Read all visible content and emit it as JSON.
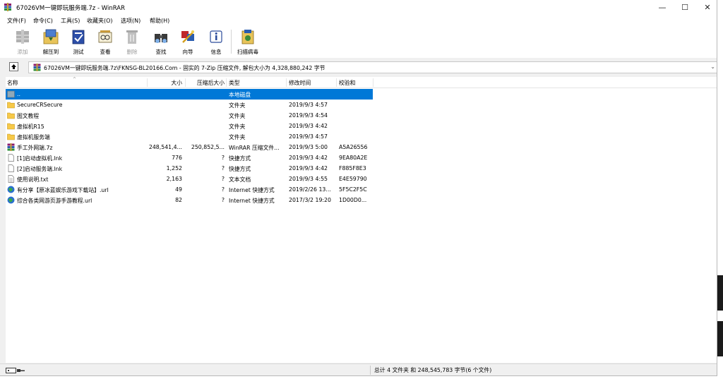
{
  "window": {
    "title": "67026VM一键即玩服务端.7z - WinRAR",
    "minimize": "—",
    "maximize": "☐",
    "close": "✕"
  },
  "menu": [
    "文件(F)",
    "命令(C)",
    "工具(S)",
    "收藏夹(O)",
    "选项(N)",
    "帮助(H)"
  ],
  "toolbar": [
    {
      "label": "添加",
      "icon": "add-icon",
      "enabled": false
    },
    {
      "label": "解压到",
      "icon": "extract-icon",
      "enabled": true
    },
    {
      "label": "测试",
      "icon": "test-icon",
      "enabled": true
    },
    {
      "label": "查看",
      "icon": "view-icon",
      "enabled": true
    },
    {
      "label": "删除",
      "icon": "delete-icon",
      "enabled": false
    },
    {
      "label": "查找",
      "icon": "find-icon",
      "enabled": true
    },
    {
      "label": "向导",
      "icon": "wizard-icon",
      "enabled": true
    },
    {
      "label": "信息",
      "icon": "info-icon",
      "enabled": true
    },
    {
      "label": "扫描病毒",
      "icon": "virus-scan-icon",
      "enabled": true
    }
  ],
  "address": {
    "path": "67026VM一键即玩服务端.7z\\FKNSG-BL20166.Com - 固实的 7-Zip 压缩文件, 解包大小为 4,328,880,242 字节"
  },
  "columns": [
    "名称",
    "大小",
    "压缩后大小",
    "类型",
    "修改时间",
    "校验和"
  ],
  "files": [
    {
      "name": "..",
      "size": "",
      "packed": "",
      "type": "本地磁盘",
      "modified": "",
      "crc": "",
      "icon": "parent-folder-icon",
      "selected": true
    },
    {
      "name": "SecureCRSecure",
      "size": "",
      "packed": "",
      "type": "文件夹",
      "modified": "2019/9/3 4:57",
      "crc": "",
      "icon": "folder-icon",
      "selected": false
    },
    {
      "name": "图文教程",
      "size": "",
      "packed": "",
      "type": "文件夹",
      "modified": "2019/9/3 4:54",
      "crc": "",
      "icon": "folder-icon",
      "selected": false
    },
    {
      "name": "虚拟机R15",
      "size": "",
      "packed": "",
      "type": "文件夹",
      "modified": "2019/9/3 4:42",
      "crc": "",
      "icon": "folder-icon",
      "selected": false
    },
    {
      "name": "虚拟机服务端",
      "size": "",
      "packed": "",
      "type": "文件夹",
      "modified": "2019/9/3 4:57",
      "crc": "",
      "icon": "folder-icon",
      "selected": false
    },
    {
      "name": "手工外网端.7z",
      "size": "248,541,4...",
      "packed": "250,852,5...",
      "type": "WinRAR 压缩文件...",
      "modified": "2019/9/3 5:00",
      "crc": "A5A26556",
      "icon": "archive-icon",
      "selected": false
    },
    {
      "name": "[1]启动虚拟机.lnk",
      "size": "776",
      "packed": "?",
      "type": "快捷方式",
      "modified": "2019/9/3 4:42",
      "crc": "9EA80A2E",
      "icon": "file-icon",
      "selected": false
    },
    {
      "name": "[2]启动服务端.lnk",
      "size": "1,252",
      "packed": "?",
      "type": "快捷方式",
      "modified": "2019/9/3 4:42",
      "crc": "F885F8E3",
      "icon": "file-icon",
      "selected": false
    },
    {
      "name": "使用说明.txt",
      "size": "2,163",
      "packed": "?",
      "type": "文本文档",
      "modified": "2019/9/3 4:55",
      "crc": "E4E59790",
      "icon": "text-file-icon",
      "selected": false
    },
    {
      "name": "有分享【原冰蓝娱乐游戏下载站】.url",
      "size": "49",
      "packed": "?",
      "type": "Internet 快捷方式",
      "modified": "2019/2/26 13...",
      "crc": "5F5C2F5C",
      "icon": "internet-shortcut-icon",
      "selected": false
    },
    {
      "name": "综合各类网游页游手游教程.url",
      "size": "82",
      "packed": "?",
      "type": "Internet 快捷方式",
      "modified": "2017/3/2 19:20",
      "crc": "1D00D0...",
      "icon": "internet-shortcut-icon",
      "selected": false
    }
  ],
  "status": {
    "summary": "总计 4 文件夹 和 248,545,783 字节(6 个文件)"
  },
  "colors": {
    "selection": "#0078d7",
    "folder": "#f7c948",
    "window_bg": "#f0f0f0"
  }
}
